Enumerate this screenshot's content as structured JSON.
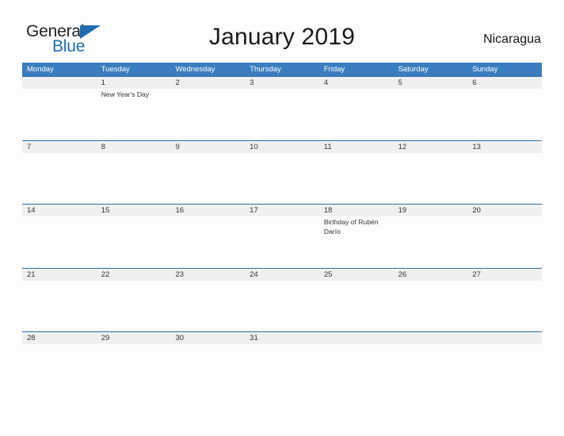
{
  "logo": {
    "word1": "General",
    "word2": "Blue",
    "triangle_color": "#1f6cb0",
    "text_color": "#231f20"
  },
  "header": {
    "title": "January 2019",
    "country": "Nicaragua"
  },
  "theme": {
    "header_blue": "#3a7ebf",
    "row_rule_blue": "#2f6ea8",
    "date_band_gray": "#f0f0f0",
    "page_background": "#fdfdfd",
    "text_color": "#333333"
  },
  "calendar": {
    "month": "January",
    "year": "2019",
    "weekdays": [
      "Monday",
      "Tuesday",
      "Wednesday",
      "Thursday",
      "Friday",
      "Saturday",
      "Sunday"
    ],
    "weeks": [
      [
        {
          "day": "",
          "event": ""
        },
        {
          "day": "1",
          "event": "New Year's Day"
        },
        {
          "day": "2",
          "event": ""
        },
        {
          "day": "3",
          "event": ""
        },
        {
          "day": "4",
          "event": ""
        },
        {
          "day": "5",
          "event": ""
        },
        {
          "day": "6",
          "event": ""
        }
      ],
      [
        {
          "day": "7",
          "event": ""
        },
        {
          "day": "8",
          "event": ""
        },
        {
          "day": "9",
          "event": ""
        },
        {
          "day": "10",
          "event": ""
        },
        {
          "day": "11",
          "event": ""
        },
        {
          "day": "12",
          "event": ""
        },
        {
          "day": "13",
          "event": ""
        }
      ],
      [
        {
          "day": "14",
          "event": ""
        },
        {
          "day": "15",
          "event": ""
        },
        {
          "day": "16",
          "event": ""
        },
        {
          "day": "17",
          "event": ""
        },
        {
          "day": "18",
          "event": "Birthday of Rubén Darío"
        },
        {
          "day": "19",
          "event": ""
        },
        {
          "day": "20",
          "event": ""
        }
      ],
      [
        {
          "day": "21",
          "event": ""
        },
        {
          "day": "22",
          "event": ""
        },
        {
          "day": "23",
          "event": ""
        },
        {
          "day": "24",
          "event": ""
        },
        {
          "day": "25",
          "event": ""
        },
        {
          "day": "26",
          "event": ""
        },
        {
          "day": "27",
          "event": ""
        }
      ],
      [
        {
          "day": "28",
          "event": ""
        },
        {
          "day": "29",
          "event": ""
        },
        {
          "day": "30",
          "event": ""
        },
        {
          "day": "31",
          "event": ""
        },
        {
          "day": "",
          "event": ""
        },
        {
          "day": "",
          "event": ""
        },
        {
          "day": "",
          "event": ""
        }
      ]
    ]
  }
}
